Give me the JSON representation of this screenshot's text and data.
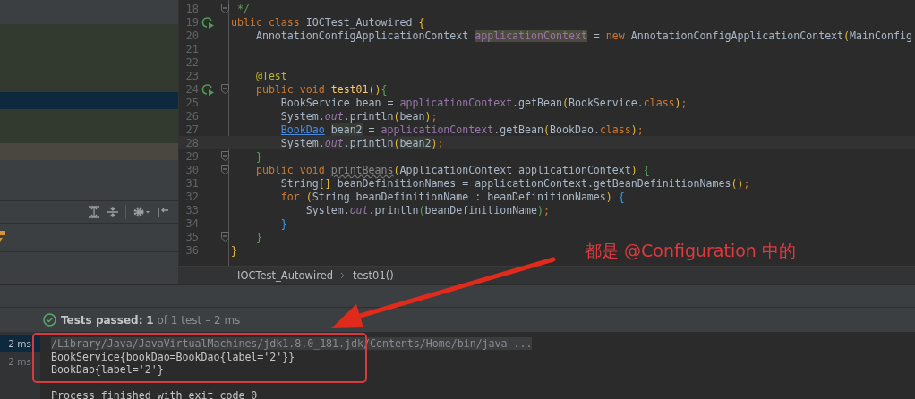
{
  "navigator": {
    "rows": [
      {
        "kind": "passed",
        "selected": false
      },
      {
        "kind": "passed",
        "selected": false
      },
      {
        "kind": "passed",
        "selected": false
      },
      {
        "kind": "passed",
        "selected": false
      },
      {
        "kind": "passed",
        "selected": true
      },
      {
        "kind": "passed",
        "selected": false
      },
      {
        "kind": "passed",
        "selected": false
      },
      {
        "kind": "modified",
        "selected": false
      }
    ]
  },
  "editor": {
    "lines": [
      {
        "number": "18",
        "run": false,
        "fold": true,
        "current": false,
        "tokens": [
          {
            "text": " */",
            "kind": "comment"
          }
        ]
      },
      {
        "number": "19",
        "run": true,
        "fold": false,
        "current": false,
        "tokens": [
          {
            "text": "ublic class ",
            "kind": "kw"
          },
          {
            "text": "IOCTest_Autowired ",
            "kind": "text"
          },
          {
            "text": "{",
            "kind": "b1"
          }
        ]
      },
      {
        "number": "20",
        "run": false,
        "fold": false,
        "current": false,
        "tokens": [
          {
            "text": "    AnnotationConfigApplicationContext ",
            "kind": "text"
          },
          {
            "text": "applicationContext",
            "kind": "fieldmark"
          },
          {
            "text": " = ",
            "kind": "text"
          },
          {
            "text": "new ",
            "kind": "kw"
          },
          {
            "text": "AnnotationConfigApplicationContext",
            "kind": "text"
          },
          {
            "text": "(",
            "kind": "b1"
          },
          {
            "text": "MainConfig",
            "kind": "text"
          }
        ]
      },
      {
        "number": "21",
        "run": false,
        "fold": false,
        "current": false
      },
      {
        "number": "22",
        "run": false,
        "fold": false,
        "current": false
      },
      {
        "number": "23",
        "run": false,
        "fold": false,
        "current": false,
        "tokens": [
          {
            "text": "    @Test",
            "kind": "ann"
          }
        ]
      },
      {
        "number": "24",
        "run": true,
        "fold": true,
        "current": false,
        "tokens": [
          {
            "text": "    public void ",
            "kind": "kw"
          },
          {
            "text": "test01",
            "kind": "decl"
          },
          {
            "text": "()",
            "kind": "b1"
          },
          {
            "text": "{",
            "kind": "b2"
          }
        ]
      },
      {
        "number": "25",
        "run": false,
        "fold": false,
        "current": false,
        "tokens": [
          {
            "text": "        BookService bean = ",
            "kind": "text"
          },
          {
            "text": "applicationContext",
            "kind": "field"
          },
          {
            "text": ".getBean",
            "kind": "text"
          },
          {
            "text": "(",
            "kind": "b1"
          },
          {
            "text": "BookService.",
            "kind": "text"
          },
          {
            "text": "class",
            "kind": "kw"
          },
          {
            "text": ")",
            "kind": "b1"
          },
          {
            "text": ";",
            "kind": "kw"
          }
        ]
      },
      {
        "number": "26",
        "run": false,
        "fold": false,
        "current": false,
        "tokens": [
          {
            "text": "        System.",
            "kind": "text"
          },
          {
            "text": "out",
            "kind": "static"
          },
          {
            "text": ".println",
            "kind": "text"
          },
          {
            "text": "(",
            "kind": "b1"
          },
          {
            "text": "bean",
            "kind": "text"
          },
          {
            "text": ")",
            "kind": "b1"
          },
          {
            "text": ";",
            "kind": "kw"
          }
        ]
      },
      {
        "number": "27",
        "run": false,
        "fold": false,
        "current": false,
        "tokens": [
          {
            "text": "        BookDao",
            "kind": "link"
          },
          {
            "text": " bean2",
            "kind": "varmark"
          },
          {
            "text": " = ",
            "kind": "text"
          },
          {
            "text": "applicationContext",
            "kind": "field"
          },
          {
            "text": ".getBean",
            "kind": "text"
          },
          {
            "text": "(",
            "kind": "b1"
          },
          {
            "text": "BookDao.",
            "kind": "text"
          },
          {
            "text": "class",
            "kind": "kw"
          },
          {
            "text": ")",
            "kind": "b1"
          },
          {
            "text": ";",
            "kind": "kw"
          }
        ]
      },
      {
        "number": "28",
        "run": false,
        "fold": false,
        "current": true,
        "tokens": [
          {
            "text": "        System.",
            "kind": "text"
          },
          {
            "text": "out",
            "kind": "static"
          },
          {
            "text": ".println",
            "kind": "text"
          },
          {
            "text": "(",
            "kind": "b1"
          },
          {
            "text": "bean2",
            "kind": "varmark"
          },
          {
            "text": ")",
            "kind": "b1"
          },
          {
            "text": ";",
            "kind": "kw"
          }
        ]
      },
      {
        "number": "29",
        "run": false,
        "fold": true,
        "current": false,
        "tokens": [
          {
            "text": "    }",
            "kind": "b2"
          }
        ]
      },
      {
        "number": "30",
        "run": false,
        "fold": true,
        "current": false,
        "tokens": [
          {
            "text": "    public void ",
            "kind": "kw"
          },
          {
            "text": "printBeans",
            "kind": "unused"
          },
          {
            "text": "(",
            "kind": "b1"
          },
          {
            "text": "ApplicationContext applicationContext",
            "kind": "text"
          },
          {
            "text": ")",
            "kind": "b1"
          },
          {
            "text": " {",
            "kind": "b2"
          }
        ]
      },
      {
        "number": "31",
        "run": false,
        "fold": false,
        "current": false,
        "tokens": [
          {
            "text": "        String",
            "kind": "text"
          },
          {
            "text": "[]",
            "kind": "b1"
          },
          {
            "text": " beanDefinitionNames = applicationContext.getBeanDefinitionNames",
            "kind": "text"
          },
          {
            "text": "()",
            "kind": "b1"
          },
          {
            "text": ";",
            "kind": "kw"
          }
        ]
      },
      {
        "number": "32",
        "run": false,
        "fold": false,
        "current": false,
        "tokens": [
          {
            "text": "        for ",
            "kind": "kw"
          },
          {
            "text": "(",
            "kind": "b1"
          },
          {
            "text": "String beanDefinitionName : beanDefinitionNames",
            "kind": "text"
          },
          {
            "text": ")",
            "kind": "b1"
          },
          {
            "text": " {",
            "kind": "b3"
          }
        ]
      },
      {
        "number": "33",
        "run": false,
        "fold": false,
        "current": false,
        "tokens": [
          {
            "text": "            System.",
            "kind": "text"
          },
          {
            "text": "out",
            "kind": "static"
          },
          {
            "text": ".println",
            "kind": "text"
          },
          {
            "text": "(",
            "kind": "b2"
          },
          {
            "text": "beanDefinitionName",
            "kind": "text"
          },
          {
            "text": ")",
            "kind": "b2"
          },
          {
            "text": ";",
            "kind": "kw"
          }
        ]
      },
      {
        "number": "34",
        "run": false,
        "fold": false,
        "current": false,
        "tokens": [
          {
            "text": "        }",
            "kind": "b3"
          }
        ]
      },
      {
        "number": "35",
        "run": false,
        "fold": true,
        "current": false,
        "tokens": [
          {
            "text": "    }",
            "kind": "b2"
          }
        ]
      },
      {
        "number": "36",
        "run": false,
        "fold": false,
        "current": false,
        "tokens": [
          {
            "text": "}",
            "kind": "b1"
          }
        ]
      }
    ],
    "breadcrumbs": [
      "IOCTest_Autowired",
      "test01()"
    ]
  },
  "run_panel": {
    "status": "**Tests passed:** **1** of 1 test – 2 ms",
    "durations": [
      {
        "text": "2 ms",
        "selected": true
      },
      {
        "text": "2 ms",
        "selected": false
      }
    ],
    "console": [
      {
        "text": "/Library/Java/JavaVirtualMachines/jdk1.8.0_181.jdk/Contents/Home/bin/java ...",
        "kind": "command"
      },
      {
        "text": "BookService{bookDao=BookDao{label='2'}}",
        "kind": "output"
      },
      {
        "text": "BookDao{label='2'}",
        "kind": "output"
      },
      {
        "kind": "blank"
      },
      {
        "text": "Process finished with exit code 0",
        "kind": "output"
      }
    ]
  },
  "annotation": {
    "text": "都是 @Configuration 中的"
  }
}
